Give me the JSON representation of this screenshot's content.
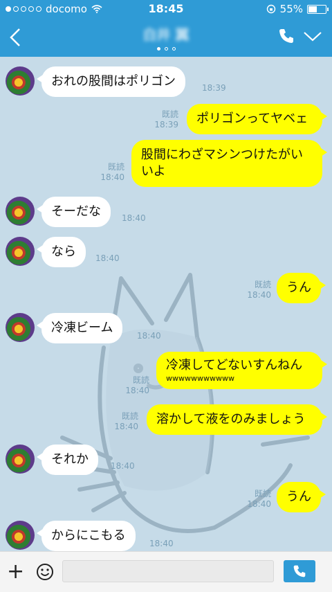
{
  "status": {
    "carrier": "docomo",
    "time": "18:45",
    "battery": "55%",
    "battery_level": 0.55
  },
  "header": {
    "contact_name": "白井 翼"
  },
  "messages": [
    {
      "text": "おれの股間はポリゴン",
      "time": "18:39"
    },
    {
      "read": "既読",
      "text": "ポリゴンってヤベェ",
      "time": "18:39"
    },
    {
      "read": "既読",
      "line1": "股間にわざマシンつけたがい",
      "line2": "いよ",
      "time": "18:40"
    },
    {
      "text": "そーだな",
      "time": "18:40"
    },
    {
      "text": "なら",
      "time": "18:40"
    },
    {
      "read": "既読",
      "text": "うん",
      "time": "18:40"
    },
    {
      "text": "冷凍ビーム",
      "time": "18:40"
    },
    {
      "read": "既読",
      "line1": "冷凍してどないすんねん",
      "line2": "wwwwwwwwwww",
      "time": "18:40"
    },
    {
      "read": "既読",
      "text": "溶かして液をのみましょう",
      "time": "18:40"
    },
    {
      "text": "それか",
      "time": "18:40"
    },
    {
      "read": "既読",
      "text": "うん",
      "time": "18:40"
    },
    {
      "text": "からにこもる",
      "time": "18:40"
    }
  ],
  "input": {
    "placeholder": ""
  },
  "colors": {
    "accent": "#2f9bd6",
    "out_bubble": "#ffff00",
    "in_bubble": "#ffffff",
    "background": "#c6dbe8"
  }
}
